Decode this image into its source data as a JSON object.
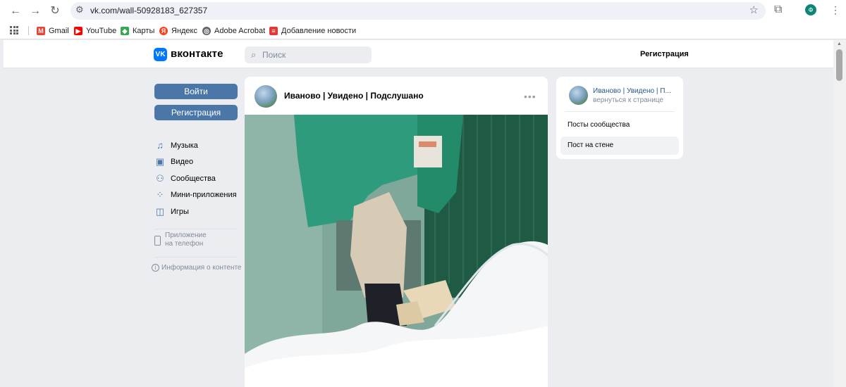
{
  "browser": {
    "url": "vk.com/wall-50928183_627357",
    "profile_initial": "Ф",
    "bookmarks": [
      {
        "label": "Gmail",
        "icon": "gmail-icon",
        "color": "#ea4335"
      },
      {
        "label": "YouTube",
        "icon": "youtube-icon",
        "color": "#ff0000"
      },
      {
        "label": "Карты",
        "icon": "maps-icon",
        "color": "#34a853"
      },
      {
        "label": "Яндекс",
        "icon": "yandex-icon",
        "color": "#fc3f1d"
      },
      {
        "label": "Adobe Acrobat",
        "icon": "globe-icon",
        "color": "#5f6368"
      },
      {
        "label": "Добавление новости",
        "icon": "news-icon",
        "color": "#e53935"
      }
    ]
  },
  "vk": {
    "brand": "вконтакте",
    "logo_text": "VK",
    "accent": "#4a76a8",
    "search_placeholder": "Поиск",
    "register_link": "Регистрация",
    "login_button": "Войти",
    "register_button": "Регистрация",
    "nav": [
      {
        "label": "Музыка",
        "icon": "music-icon"
      },
      {
        "label": "Видео",
        "icon": "video-icon"
      },
      {
        "label": "Сообщества",
        "icon": "communities-icon"
      },
      {
        "label": "Мини-приложения",
        "icon": "mini-apps-icon"
      },
      {
        "label": "Игры",
        "icon": "games-icon"
      }
    ],
    "app_promo": {
      "line1": "Приложение",
      "line2": "на телефон"
    },
    "content_info": "Информация о контенте"
  },
  "post": {
    "author": "Иваново | Увидено | Подслушано",
    "menu": "•••"
  },
  "sidebar": {
    "community_name": "Иваново | Увидено | П...",
    "back_link": "вернуться к странице",
    "items": [
      {
        "label": "Посты сообщества",
        "active": false
      },
      {
        "label": "Пост на стене",
        "active": true
      }
    ]
  }
}
